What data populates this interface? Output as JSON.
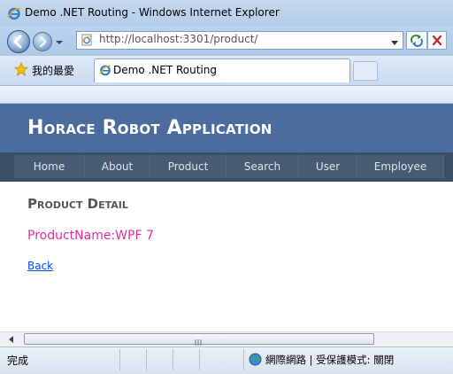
{
  "window": {
    "title": "Demo .NET Routing - Windows Internet Explorer",
    "icon": "ie-icon"
  },
  "addressbar": {
    "url": "http://localhost:3301/product/",
    "buttons": [
      "back-icon",
      "forward-icon",
      "refresh-icon",
      "stop-icon"
    ]
  },
  "favorites": {
    "label": "我的最愛",
    "icon": "star-icon"
  },
  "tabs": [
    {
      "label": "Demo .NET Routing",
      "active": true
    }
  ],
  "site": {
    "title": "Horace Robot Application",
    "header_color": "#4b6c9e",
    "nav_color": "#465c71",
    "menu": [
      {
        "label": "Home"
      },
      {
        "label": "About"
      },
      {
        "label": "Product"
      },
      {
        "label": "Search"
      },
      {
        "label": "User"
      },
      {
        "label": "Employee"
      }
    ]
  },
  "main": {
    "heading": "Product Detail",
    "product_line": "ProductName:WPF 7",
    "product_color": "#e02e9a",
    "back_link": "Back"
  },
  "statusbar": {
    "status": "完成",
    "zone": "網際網路 | 受保護模式: 關閉",
    "zone_icon": "globe-icon"
  }
}
